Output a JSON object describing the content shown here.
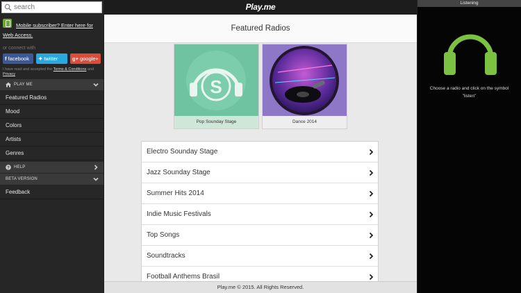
{
  "app": {
    "logo": "Play.me"
  },
  "sidebar": {
    "search_placeholder": "search",
    "mobile_text": "Mobile subscriber? Enter here for Web Access.",
    "connect_label": "or connect with",
    "social": {
      "facebook": "facebook",
      "twitter": "twitter",
      "google": "google+"
    },
    "terms_prefix": "I have read and accepted the ",
    "terms_link": "Terms & Conditions",
    "terms_and": " and ",
    "privacy_link": "Privacy",
    "section_playme": "PLAY ME",
    "items": [
      "Featured Radios",
      "Mood",
      "Colors",
      "Artists",
      "Genres"
    ],
    "section_help": "HELP",
    "section_beta": "BETA VERSION",
    "feedback": "Feedback"
  },
  "main": {
    "title": "Featured Radios",
    "cards": [
      {
        "caption": "Pop Sounday Stage"
      },
      {
        "caption": "Dance 2014"
      }
    ],
    "radios": [
      "Electro Sounday Stage",
      "Jazz Sounday Stage",
      "Summer Hits 2014",
      "Indie Music Festivals",
      "Top Songs",
      "Soundtracks",
      "Football Anthems Brasil"
    ],
    "footer": "Play.me © 2015. All Rights Reserved."
  },
  "listening": {
    "title": "Listening",
    "instructions": "Choose a radio and click on the symbol \"listen\""
  },
  "colors": {
    "accent_green": "#7cc242",
    "sidebar_bg": "#262626",
    "main_bg": "#e9e9e9"
  }
}
